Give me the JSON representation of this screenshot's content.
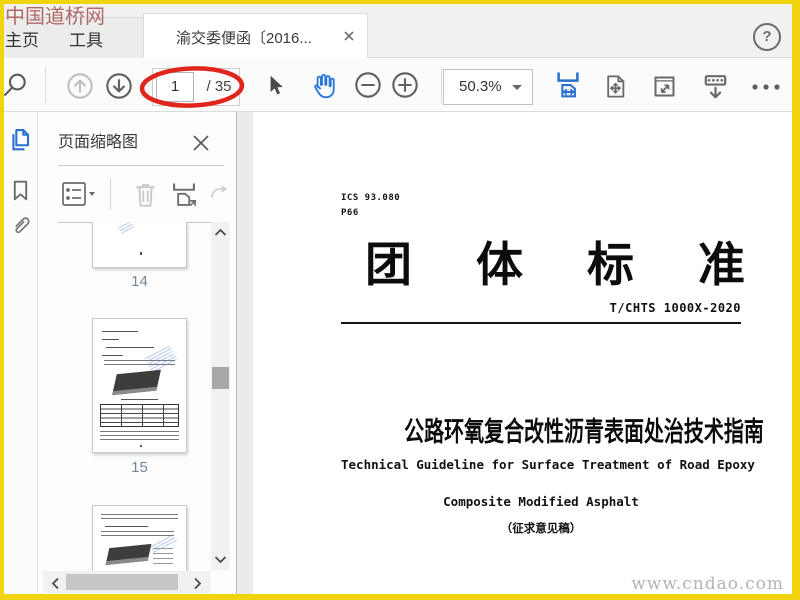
{
  "window": {
    "help_icon": "?",
    "watermark_top_left": "中国道桥网",
    "watermark_bottom_right": "www.cndao.com"
  },
  "tab_bar": {
    "home_tab": "主页",
    "tools_tab": "工具",
    "document_tab": "渝交委便函〔2016..."
  },
  "toolbar": {
    "page_current": "1",
    "page_total": "/ 35",
    "zoom_level": "50.3%"
  },
  "sidebar": {
    "panel_title": "页面缩略图",
    "thumbnails": [
      {
        "number": "14"
      },
      {
        "number": "15"
      },
      {
        "number": ""
      }
    ]
  },
  "document": {
    "ics": "ICS 93.080",
    "classification": "P66",
    "standard_type": "团体标准",
    "standard_type_chars": [
      "团",
      "体",
      "标",
      "准"
    ],
    "standard_number": "T/CHTS 1000X-2020",
    "title_cn": "公路环氧复合改性沥青表面处治技术指南",
    "title_en_line1": "Technical Guideline for Surface Treatment of Road Epoxy",
    "title_en_line2": "Composite Modified Asphalt",
    "draft_note": "（征求意见稿）"
  },
  "icons": [
    "search-icon",
    "previous-page-icon",
    "next-page-icon",
    "select-arrow-icon",
    "hand-tool-icon",
    "zoom-out-icon",
    "zoom-in-icon",
    "fit-width-icon",
    "fit-page-icon",
    "actual-size-icon",
    "scroll-mode-icon",
    "more-tools-icon",
    "help-icon",
    "page-thumbnails-icon",
    "bookmarks-icon",
    "attachments-icon",
    "options-icon",
    "delete-icon",
    "resize-pages-icon",
    "rotate-icon",
    "close-icon"
  ],
  "colors": {
    "frame_yellow": "#f0d40e",
    "accent_blue": "#2b72d0",
    "annotation_red": "#e0261c"
  }
}
